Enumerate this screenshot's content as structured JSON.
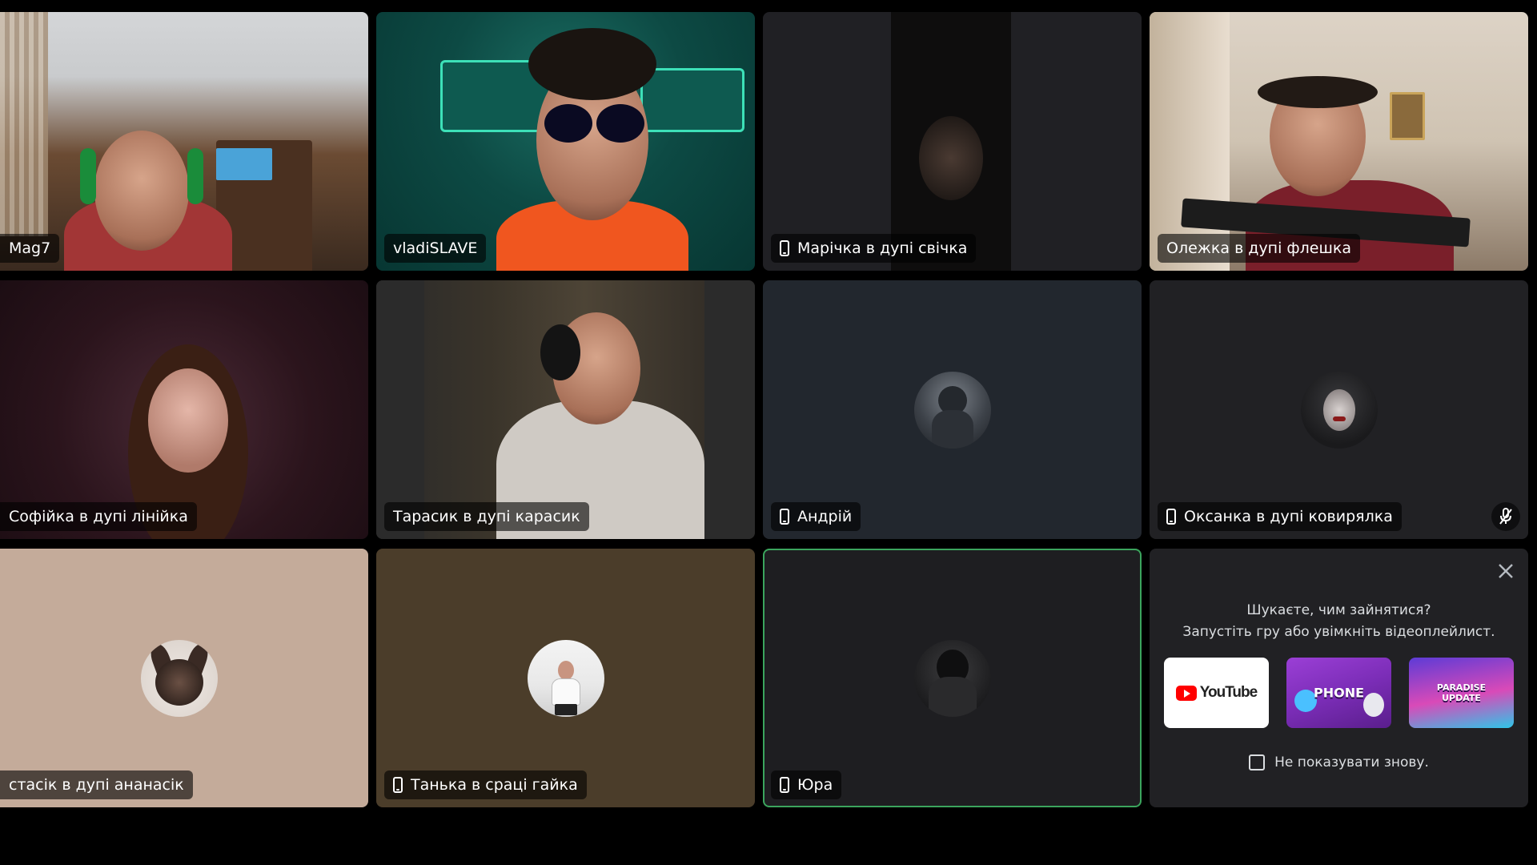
{
  "participants": [
    {
      "name": "Mag7",
      "mobile": false
    },
    {
      "name": "vladiSLAVE",
      "mobile": false
    },
    {
      "name": "Марічка в дупі свічка",
      "mobile": true
    },
    {
      "name": "Олежка в дупі флешка",
      "mobile": false
    },
    {
      "name": "Софійка в дупі лінійка",
      "mobile": false
    },
    {
      "name": "Тарасик в дупі карасик",
      "mobile": false
    },
    {
      "name": "Андрій",
      "mobile": true
    },
    {
      "name": "Оксанка в дупі ковирялка",
      "mobile": true,
      "muted": true
    },
    {
      "name": "стасік в дупі ананасік",
      "mobile": false
    },
    {
      "name": "Танька в сраці гайка",
      "mobile": true
    },
    {
      "name": "Юра",
      "mobile": true,
      "speaking": true
    }
  ],
  "promo": {
    "line1": "Шукаєте, чим зайнятися?",
    "line2": "Запустіть гру або увімкніть відеоплейлист.",
    "cards": [
      {
        "label": "YouTube",
        "icon": "youtube-logo"
      },
      {
        "label": "PHONE",
        "icon": "gartic-phone-thumbnail"
      },
      {
        "label": "PARADISE UPDATE",
        "icon": "activity-thumbnail"
      }
    ],
    "dont_show_label": "Не показувати знову.",
    "close_icon": "close-icon"
  },
  "colors": {
    "speaking_border": "#3ba55d",
    "background": "#000000",
    "tile_dark": "#212124"
  }
}
